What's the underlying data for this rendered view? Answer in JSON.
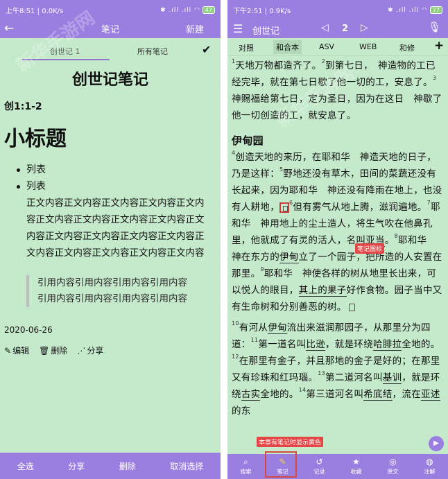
{
  "left": {
    "status": {
      "time": "上午8:51",
      "speed": "0.0K/s",
      "icons": "✱ .ıll .ıll ◠",
      "battery": "47"
    },
    "appbar": {
      "title": "笔记",
      "new_label": "新建"
    },
    "tabs": {
      "current": "创世记 1",
      "all": "所有笔记"
    },
    "note": {
      "title": "创世记笔记",
      "ref": "创1:1-2",
      "heading": "小标题",
      "list": [
        "列表",
        "列表"
      ],
      "body": "正文内容正文内容正文内容正文内容正文内容正文内容正文内容正文内容正文内容正文内容正文内容正文内容正文内容正文内容正文内容正文内容正文内容正文内容正文内容",
      "quote": "引用内容引用内容引用内容引用内容引用内容引用内容引用内容引用内容",
      "date": "2020-06-26",
      "actions": {
        "edit": "编辑",
        "delete": "删除",
        "share": "分享"
      }
    },
    "bottom": {
      "select_all": "全选",
      "share": "分享",
      "delete": "删除",
      "cancel": "取消选择"
    }
  },
  "right": {
    "status": {
      "time": "下午2:51",
      "speed": "0.9K/s",
      "icons": "✱ .ıll .ıll ◠",
      "battery": "77"
    },
    "appbar": {
      "book": "创世记",
      "chapter": "2"
    },
    "tabs": [
      "对照",
      "和合本",
      "ASV",
      "WEB",
      "和修"
    ],
    "verses": {
      "v1": "天地万物都造齐了。",
      "v2": "到第七日，　神造物的工已经完毕，就在第七日歇了他一切的工，安息了。",
      "v3": "　神赐福给第七日，定为圣日，因为在这日　神歇了他一切创造的工，就安息了。",
      "section": "伊甸园",
      "v4": "创造天地的来历，在耶和华　神造天地的日子，乃是这样：",
      "v5": "野地还没有草木，田间的菜蔬还没有长起来，因为耶和华　神还没有降雨在地上，也没有人耕地，",
      "v6": "但有雾气从地上腾，滋润遍地。",
      "v7a": "耶和华　神用地上的尘土造人，将生气吹在他鼻孔里，他就成了有灵的活人，名叫",
      "v7name": "亚当",
      "v8a": "耶和华　神在东方的",
      "v8place": "伊甸",
      "v8b": "立了一个园子，把所造的人安置在那里。",
      "v9a": "耶和华　神使各样的树从地里长出来，可以悦人的眼目，",
      "v9u": "其上的果子",
      "v9b": "好作食物。园子当中又有生命树和分别善恶的树。",
      "v10a": "有河从",
      "v10place": "伊甸",
      "v10b": "流出来滋润那园子，从那里分为四道：",
      "v11a": "第一道名叫",
      "v11name": "比逊",
      "v11b": "，就是环绕",
      "v11place": "哈腓拉",
      "v11c": "全地的。",
      "v12": "在那里有金子，并且那地的金子是好的；在那里又有珍珠和红玛瑙。",
      "v13a": "第二道河名叫",
      "v13name": "基训",
      "v13b": "，就是环绕",
      "v13place": "古实",
      "v13c": "全地的。",
      "v14a": "第三道河名叫",
      "v14name": "希底结",
      "v14b": "，流在",
      "v14place": "亚述",
      "v14c": "的东"
    },
    "labels": {
      "note_icon": "笔记图标",
      "yellow_hint": "本章有笔记时显示黄色"
    },
    "bottom": [
      "搜索",
      "笔记",
      "记录",
      "收藏",
      "原文",
      "注解"
    ]
  },
  "watermark": "新华手游网",
  "colors": {
    "accent": "#9b7fe0",
    "background": "#c5eacb",
    "highlight": "#d24c45"
  }
}
